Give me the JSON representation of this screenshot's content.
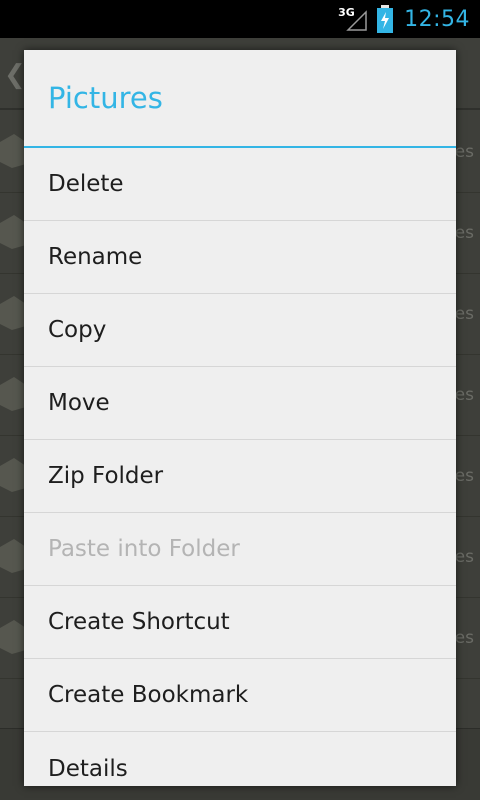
{
  "status_bar": {
    "network_type": "3G",
    "time": "12:54"
  },
  "background": {
    "row_tail_text": "es",
    "rows": 7
  },
  "dialog": {
    "title": "Pictures",
    "items": [
      {
        "label": "Delete",
        "enabled": true
      },
      {
        "label": "Rename",
        "enabled": true
      },
      {
        "label": "Copy",
        "enabled": true
      },
      {
        "label": "Move",
        "enabled": true
      },
      {
        "label": "Zip Folder",
        "enabled": true
      },
      {
        "label": "Paste into Folder",
        "enabled": false
      },
      {
        "label": "Create Shortcut",
        "enabled": true
      },
      {
        "label": "Create Bookmark",
        "enabled": true
      },
      {
        "label": "Details",
        "enabled": true
      }
    ]
  },
  "colors": {
    "accent": "#33b5e5",
    "dialog_bg": "#efefef",
    "disabled_text": "#b4b4b4"
  }
}
